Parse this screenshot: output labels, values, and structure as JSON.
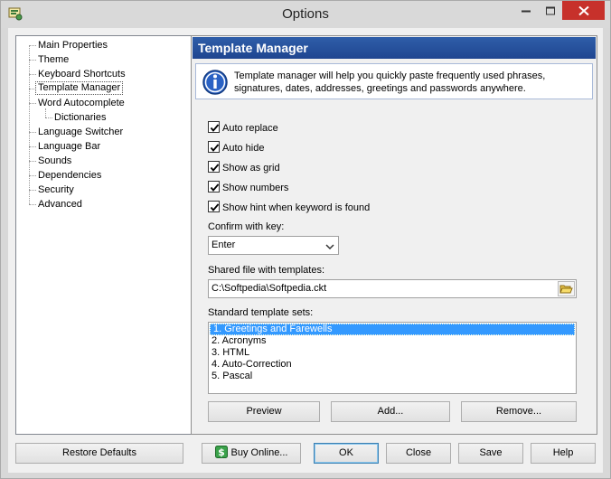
{
  "window": {
    "title": "Options",
    "colors": {
      "close_button": "#c7312b",
      "header_blue": "#2f5ea9",
      "selection_blue": "#3399ff"
    }
  },
  "tree": {
    "items": [
      {
        "label": "Main Properties"
      },
      {
        "label": "Theme"
      },
      {
        "label": "Keyboard Shortcuts"
      },
      {
        "label": "Template Manager"
      },
      {
        "label": "Word Autocomplete"
      },
      {
        "label": "Dictionaries"
      },
      {
        "label": "Language Switcher"
      },
      {
        "label": "Language Bar"
      },
      {
        "label": "Sounds"
      },
      {
        "label": "Dependencies"
      },
      {
        "label": "Security"
      },
      {
        "label": "Advanced"
      }
    ],
    "selected": "Template Manager"
  },
  "panel": {
    "title": "Template Manager",
    "info": "Template manager will help you quickly paste frequently used phrases, signatures, dates, addresses, greetings and passwords anywhere.",
    "checkboxes": [
      {
        "label": "Auto replace",
        "checked": true
      },
      {
        "label": "Auto hide",
        "checked": true
      },
      {
        "label": "Show as grid",
        "checked": true
      },
      {
        "label": "Show numbers",
        "checked": true
      },
      {
        "label": "Show hint when keyword is found",
        "checked": true
      }
    ],
    "confirm_label": "Confirm with key:",
    "confirm_value": "Enter",
    "shared_file_label": "Shared file with templates:",
    "shared_file_value": "C:\\Softpedia\\Softpedia.ckt",
    "template_sets_label": "Standard template sets:",
    "template_sets": [
      "1. Greetings and Farewells",
      "2. Acronyms",
      "3. HTML",
      "4. Auto-Correction",
      "5. Pascal"
    ],
    "preview_button": "Preview",
    "add_button": "Add...",
    "remove_button": "Remove..."
  },
  "footer": {
    "restore_defaults": "Restore Defaults",
    "buy_online": "Buy Online...",
    "ok": "OK",
    "close": "Close",
    "save": "Save",
    "help": "Help"
  }
}
